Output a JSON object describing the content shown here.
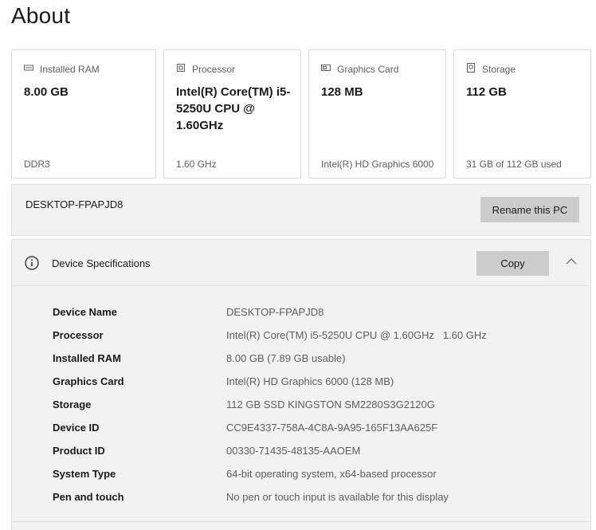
{
  "page": {
    "title": "About"
  },
  "cards": [
    {
      "label": "Installed RAM",
      "icon": "ram-icon",
      "value": "8.00 GB",
      "sub": "DDR3"
    },
    {
      "label": "Processor",
      "icon": "processor-icon",
      "value": "Intel(R) Core(TM) i5-5250U CPU @ 1.60GHz",
      "sub": "1.60 GHz"
    },
    {
      "label": "Graphics Card",
      "icon": "graphics-card-icon",
      "value": "128 MB",
      "sub": "Intel(R) HD Graphics 6000"
    },
    {
      "label": "Storage",
      "icon": "storage-icon",
      "value": "112 GB",
      "sub": "31 GB of 112 GB used"
    }
  ],
  "rename": {
    "pc_name": "DESKTOP-FPAPJD8",
    "button_label": "Rename this PC"
  },
  "specs": {
    "title": "Device Specifications",
    "copy_label": "Copy",
    "rows": [
      {
        "label": "Device Name",
        "value": "DESKTOP-FPAPJD8"
      },
      {
        "label": "Processor",
        "value": "Intel(R) Core(TM) i5-5250U CPU @ 1.60GHz   1.60 GHz"
      },
      {
        "label": "Installed RAM",
        "value": "8.00 GB (7.89 GB usable)"
      },
      {
        "label": "Graphics Card",
        "value": "Intel(R) HD Graphics 6000 (128 MB)"
      },
      {
        "label": "Storage",
        "value": "112 GB SSD KINGSTON SM2280S3G2120G"
      },
      {
        "label": "Device ID",
        "value": "CC9E4337-758A-4C8A-9A95-165F13AA625F"
      },
      {
        "label": "Product ID",
        "value": "00330-71435-48135-AAOEM"
      },
      {
        "label": "System Type",
        "value": "64-bit operating system, x64-based processor"
      },
      {
        "label": "Pen and touch",
        "value": "No pen or touch input is available for this display"
      }
    ]
  }
}
